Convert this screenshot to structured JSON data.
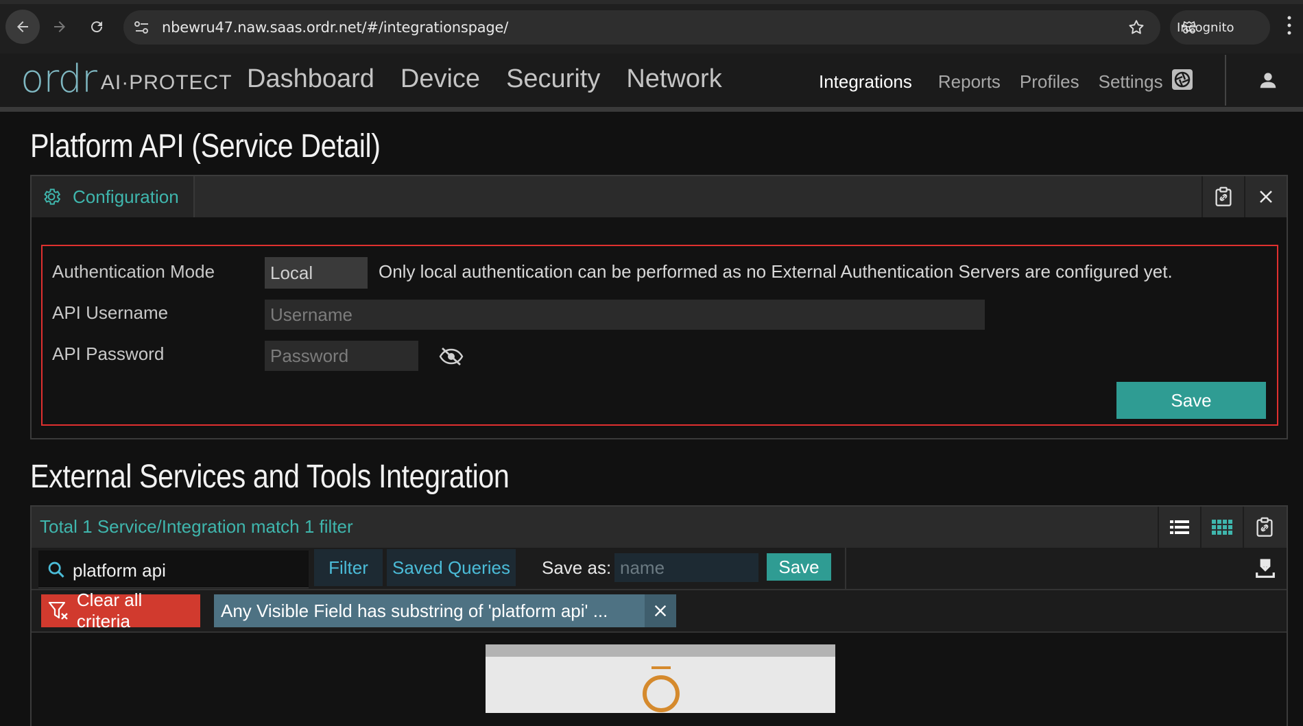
{
  "browser": {
    "url": "nbewru47.naw.saas.ordr.net/#/integrationspage/",
    "incognito_label": "Incognito"
  },
  "app": {
    "logo_text": "ordr",
    "logo_tag": "AI·PROTECT",
    "main_nav": [
      "Dashboard",
      "Device",
      "Security",
      "Network"
    ],
    "sub_nav": [
      "Integrations",
      "Reports",
      "Profiles",
      "Settings"
    ],
    "active_sub_nav": "Integrations"
  },
  "platform_api": {
    "title": "Platform API (Service Detail)",
    "tab_label": "Configuration",
    "auth_mode_label": "Authentication Mode",
    "auth_mode_value": "Local",
    "auth_mode_note": "Only local authentication can be performed as no External Authentication Servers are configured yet.",
    "username_label": "API Username",
    "username_placeholder": "Username",
    "password_label": "API Password",
    "password_placeholder": "Password",
    "save_label": "Save"
  },
  "external": {
    "title": "External Services and Tools Integration",
    "summary": "Total 1 Service/Integration match 1 filter",
    "search_value": "platform api",
    "filter_label": "Filter",
    "saved_queries_label": "Saved Queries",
    "save_as_label": "Save as:",
    "name_placeholder": "name",
    "save_label": "Save",
    "clear_label": "Clear all criteria",
    "chip_text": "Any Visible Field has substring of 'platform api' ..."
  },
  "colors": {
    "accent_teal": "#3fb6ad",
    "save_button": "#2f9c93",
    "error_border": "#e0302f",
    "clear_button": "#d13a2e",
    "chip": "#4e7283"
  }
}
